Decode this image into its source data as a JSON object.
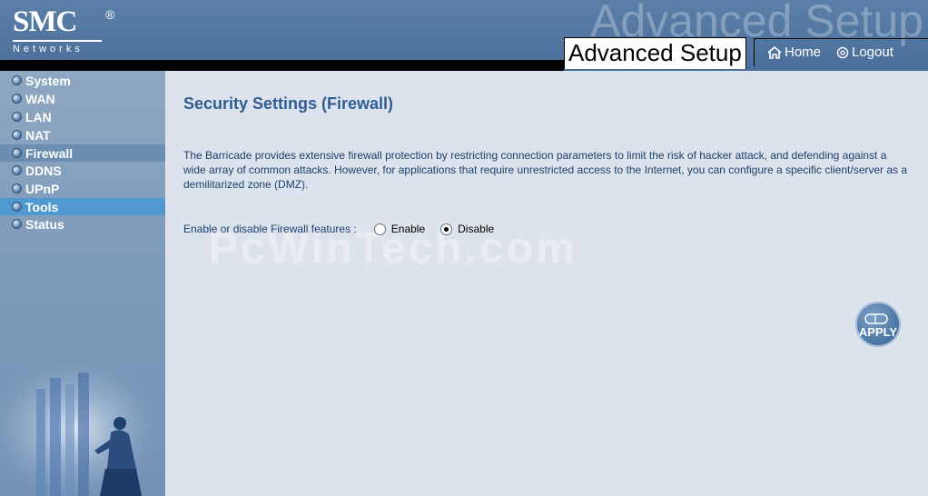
{
  "header": {
    "logo": "SMC",
    "logo_reg": "®",
    "logo_sub": "Networks",
    "bg_title": "Advanced Setup",
    "title": "Advanced Setup",
    "home_label": "Home",
    "logout_label": "Logout"
  },
  "sidebar": {
    "items": [
      {
        "label": "System"
      },
      {
        "label": "WAN"
      },
      {
        "label": "LAN"
      },
      {
        "label": "NAT"
      },
      {
        "label": "Firewall"
      },
      {
        "label": "DDNS"
      },
      {
        "label": "UPnP"
      },
      {
        "label": "Tools"
      },
      {
        "label": "Status"
      }
    ],
    "selected": "Firewall",
    "hover": "Tools"
  },
  "main": {
    "title": "Security Settings (Firewall)",
    "description": "The Barricade provides extensive firewall protection by restricting connection parameters to limit the risk of hacker attack, and defending against a wide array of common attacks. However, for applications that require unrestricted access to the Internet, you can configure a specific client/server as a demilitarized zone (DMZ).",
    "firewall_label": "Enable or disable Firewall features :",
    "enable_label": "Enable",
    "disable_label": "Disable",
    "selected_option": "Disable",
    "apply_label": "APPLY",
    "watermark": "PcWinTech.com"
  },
  "colors": {
    "accent": "#2f5d92",
    "header": "#4a6f9a",
    "sidebar": "#7f9bba",
    "content_bg": "#dde3ec"
  }
}
